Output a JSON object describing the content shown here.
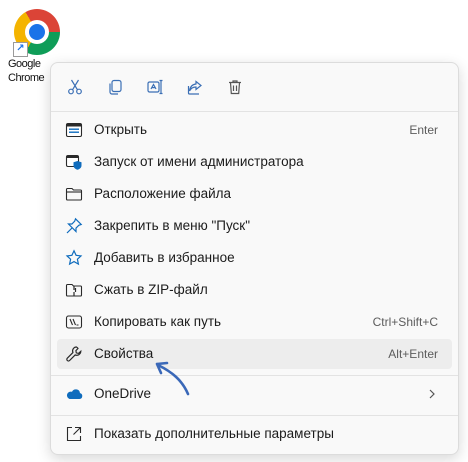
{
  "desktop_icon": {
    "label": "Google\nChrome",
    "icon": "chrome-icon",
    "overlay": "shortcut-arrow-icon"
  },
  "toolbar": {
    "buttons": [
      {
        "name": "cut",
        "icon": "scissors-icon"
      },
      {
        "name": "copy",
        "icon": "copy-icon"
      },
      {
        "name": "rename",
        "icon": "rename-icon"
      },
      {
        "name": "share",
        "icon": "share-icon"
      },
      {
        "name": "delete",
        "icon": "trash-icon"
      }
    ]
  },
  "menu": {
    "items": [
      {
        "label": "Открыть",
        "shortcut": "Enter",
        "icon": "open-window-icon"
      },
      {
        "label": "Запуск от имени администратора",
        "icon": "admin-shield-icon"
      },
      {
        "label": "Расположение файла",
        "icon": "folder-icon"
      },
      {
        "label": "Закрепить в меню \"Пуск\"",
        "icon": "pin-icon"
      },
      {
        "label": "Добавить в избранное",
        "icon": "star-icon"
      },
      {
        "label": "Сжать в ZIP-файл",
        "icon": "zip-folder-icon"
      },
      {
        "label": "Копировать как путь",
        "shortcut": "Ctrl+Shift+C",
        "icon": "copy-path-icon"
      },
      {
        "label": "Свойства",
        "shortcut": "Alt+Enter",
        "icon": "wrench-icon",
        "highlighted": true
      },
      {
        "label": "OneDrive",
        "icon": "onedrive-cloud-icon",
        "submenu": true
      },
      {
        "label": "Показать дополнительные параметры",
        "icon": "more-options-icon"
      }
    ]
  },
  "colors": {
    "accent": "#0f6cbd",
    "annotation_arrow": "#3a68b8",
    "hover": "#ededed"
  }
}
